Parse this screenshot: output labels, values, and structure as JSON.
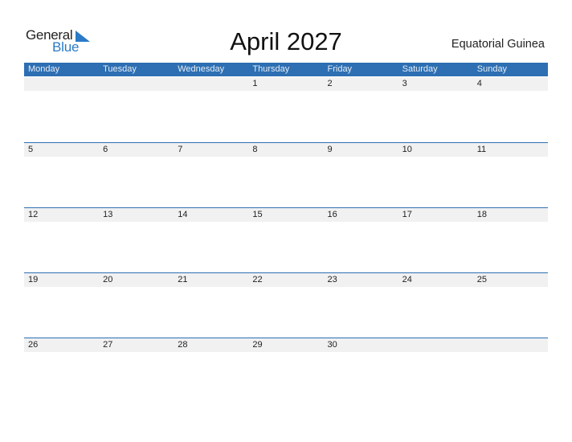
{
  "logo": {
    "line1": "General",
    "line2": "Blue"
  },
  "title": "April 2027",
  "country": "Equatorial Guinea",
  "weekdays": [
    "Monday",
    "Tuesday",
    "Wednesday",
    "Thursday",
    "Friday",
    "Saturday",
    "Sunday"
  ],
  "weeks": [
    [
      "",
      "",
      "",
      "1",
      "2",
      "3",
      "4"
    ],
    [
      "5",
      "6",
      "7",
      "8",
      "9",
      "10",
      "11"
    ],
    [
      "12",
      "13",
      "14",
      "15",
      "16",
      "17",
      "18"
    ],
    [
      "19",
      "20",
      "21",
      "22",
      "23",
      "24",
      "25"
    ],
    [
      "26",
      "27",
      "28",
      "29",
      "30",
      "",
      ""
    ]
  ],
  "colors": {
    "header": "#2d6fb2",
    "brand_blue": "#2a7ac7",
    "day_bar": "#f1f1f1"
  }
}
